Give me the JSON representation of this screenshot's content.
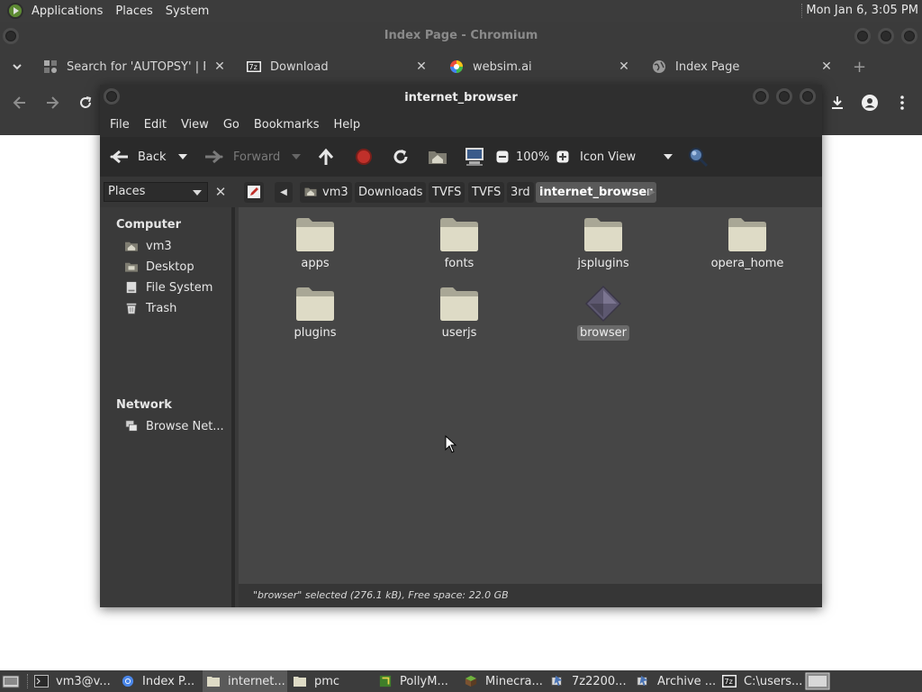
{
  "top_panel": {
    "menus": [
      "Applications",
      "Places",
      "System"
    ],
    "clock": "Mon Jan  6,  3:05 PM"
  },
  "chromium": {
    "window_title": "Index Page - Chromium",
    "tabs": [
      {
        "title": "Search for 'AUTOPSY' | Fla",
        "icon": "flathub-icon"
      },
      {
        "title": "Download",
        "icon": "7zip-icon"
      },
      {
        "title": "websim.ai",
        "icon": "websim-icon"
      },
      {
        "title": "Index Page",
        "icon": "globe-icon"
      }
    ],
    "new_tab_symbol": "+",
    "tab_close_symbol": "✕"
  },
  "file_manager": {
    "title": "internet_browser",
    "menu": [
      "File",
      "Edit",
      "View",
      "Go",
      "Bookmarks",
      "Help"
    ],
    "toolbar": {
      "back": "Back",
      "forward": "Forward",
      "zoom": "100%",
      "view_mode": "Icon View"
    },
    "sidebar_selector": "Places",
    "breadcrumbs": [
      "vm3",
      "Downloads",
      "TVFS",
      "TVFS",
      "3rd",
      "internet_browser"
    ],
    "sidebar": {
      "computer_heading": "Computer",
      "computer_items": [
        {
          "label": "vm3",
          "icon": "home-folder-icon"
        },
        {
          "label": "Desktop",
          "icon": "desktop-folder-icon"
        },
        {
          "label": "File System",
          "icon": "drive-icon"
        },
        {
          "label": "Trash",
          "icon": "trash-icon"
        }
      ],
      "network_heading": "Network",
      "network_items": [
        {
          "label": "Browse Net...",
          "icon": "network-icon"
        }
      ]
    },
    "items": [
      {
        "name": "apps",
        "type": "folder"
      },
      {
        "name": "fonts",
        "type": "folder"
      },
      {
        "name": "jsplugins",
        "type": "folder"
      },
      {
        "name": "opera_home",
        "type": "folder"
      },
      {
        "name": "plugins",
        "type": "folder"
      },
      {
        "name": "userjs",
        "type": "folder"
      },
      {
        "name": "browser",
        "type": "executable",
        "selected": true
      }
    ],
    "status": "\"browser\" selected (276.1 kB), Free space: 22.0 GB"
  },
  "taskbar": {
    "tasks": [
      {
        "label": "vm3@v...",
        "icon": "terminal-icon"
      },
      {
        "label": "Index P...",
        "icon": "chromium-icon"
      },
      {
        "label": "internet...",
        "icon": "folder-icon",
        "active": true
      },
      {
        "label": "pmc",
        "icon": "folder-icon"
      },
      {
        "label": "PollyM...",
        "icon": "polly-icon"
      },
      {
        "label": "Minecra...",
        "icon": "minecraft-icon"
      },
      {
        "label": "7z2200...",
        "icon": "installer-icon"
      },
      {
        "label": "Archive ...",
        "icon": "archive-icon"
      },
      {
        "label": "C:\\users...",
        "icon": "7zip-icon"
      }
    ]
  },
  "colors": {
    "panel": "#3c3c3c",
    "window_bg": "#3a3a3a",
    "content_bg": "#464646",
    "selection": "#6a6a6a",
    "stop_red": "#c0302a",
    "folder": "#dedbc6"
  }
}
